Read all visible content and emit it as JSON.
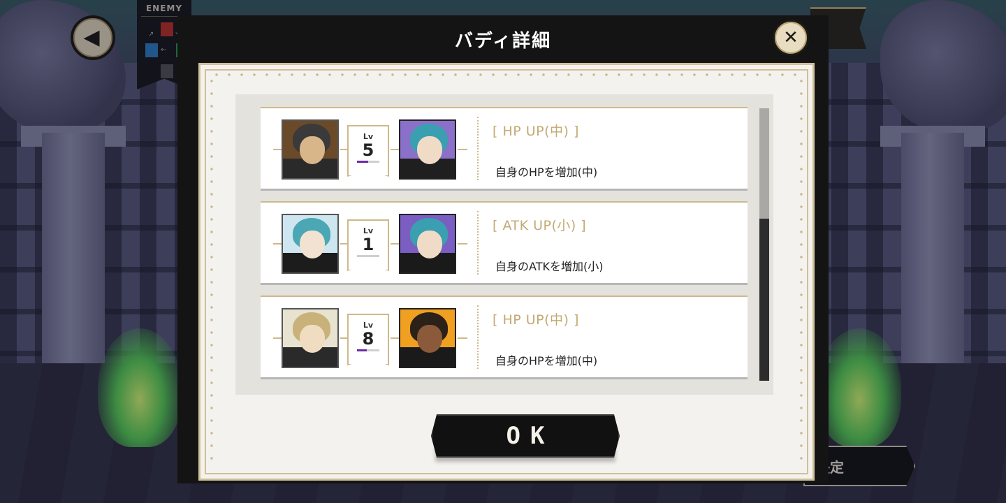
{
  "hud": {
    "enemy_label": "ENEMY",
    "decide_label": "決定"
  },
  "modal": {
    "title": "バディ詳細",
    "close_icon": "close-icon",
    "ok_label": "OK"
  },
  "buddies": [
    {
      "level_label": "Lv",
      "level": "5",
      "level_progress": 0.5,
      "skill_name": "[ HP UP(中) ]",
      "skill_desc": "自身のHPを増加(中)",
      "main_colors": {
        "hair": "#3a3a3a",
        "face": "#d9b58a",
        "bg": "#6b4a2a",
        "coat": "#2a2a2a"
      },
      "buddy_colors": {
        "hair": "#3a9fb0",
        "face": "#f0dcc6",
        "bg": "#8a70c8",
        "coat": "#1f1f1f"
      }
    },
    {
      "level_label": "Lv",
      "level": "1",
      "level_progress": 0.0,
      "skill_name": "[ ATK UP(小) ]",
      "skill_desc": "自身のATKを増加(小)",
      "main_colors": {
        "hair": "#4aa7b3",
        "face": "#f1e2d2",
        "bg": "#cde6f0",
        "coat": "#1c1c1c"
      },
      "buddy_colors": {
        "hair": "#3a9fb0",
        "face": "#f0dcc6",
        "bg": "#7a5ec2",
        "coat": "#1a1a1a"
      }
    },
    {
      "level_label": "Lv",
      "level": "8",
      "level_progress": 0.45,
      "skill_name": "[ HP UP(中) ]",
      "skill_desc": "自身のHPを増加(中)",
      "main_colors": {
        "hair": "#c8b27a",
        "face": "#f0dcc0",
        "bg": "#e8e2d0",
        "coat": "#2a2a2a"
      },
      "buddy_colors": {
        "hair": "#2b2118",
        "face": "#8a5a3a",
        "bg": "#f0a020",
        "coat": "#1a1a1a"
      }
    }
  ]
}
